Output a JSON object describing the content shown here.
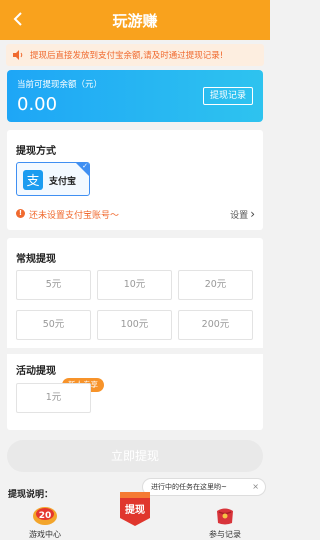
{
  "header": {
    "title": "玩游赚",
    "back_icon": "chevron-left-icon"
  },
  "notice": {
    "text": "提现后直接发放到支付宝余额,请及时通过提现记录!",
    "icon": "speaker-icon"
  },
  "balance": {
    "label": "当前可提现余额（元）",
    "value": "0.00",
    "record_button": "提现记录"
  },
  "method": {
    "title": "提现方式",
    "option": {
      "logo_char": "支",
      "label": "支付宝",
      "selected": true
    },
    "warning": "还未设置支付宝账号～",
    "settings_label": "设置",
    "settings_chevron": "›"
  },
  "regular": {
    "title": "常规提现",
    "amounts": [
      "5元",
      "10元",
      "20元",
      "50元",
      "100元",
      "200元"
    ]
  },
  "activity": {
    "title": "活动提现",
    "badge": "新人专享",
    "amount": "1元"
  },
  "withdraw_button": "立即提现",
  "explain_label": "提现说明：",
  "tooltip": {
    "text": "进行中的任务在这里哟~",
    "close": "×"
  },
  "bottom_nav": {
    "game_center": {
      "label": "游戏中心",
      "badge": "20"
    },
    "center": {
      "label": "提现"
    },
    "records": {
      "label": "参与记录"
    }
  },
  "colors": {
    "header": "#f9a21d",
    "accent_orange": "#f06a2f",
    "card_blue": "#1ea6f6",
    "alipay_blue": "#3f8ff2"
  }
}
